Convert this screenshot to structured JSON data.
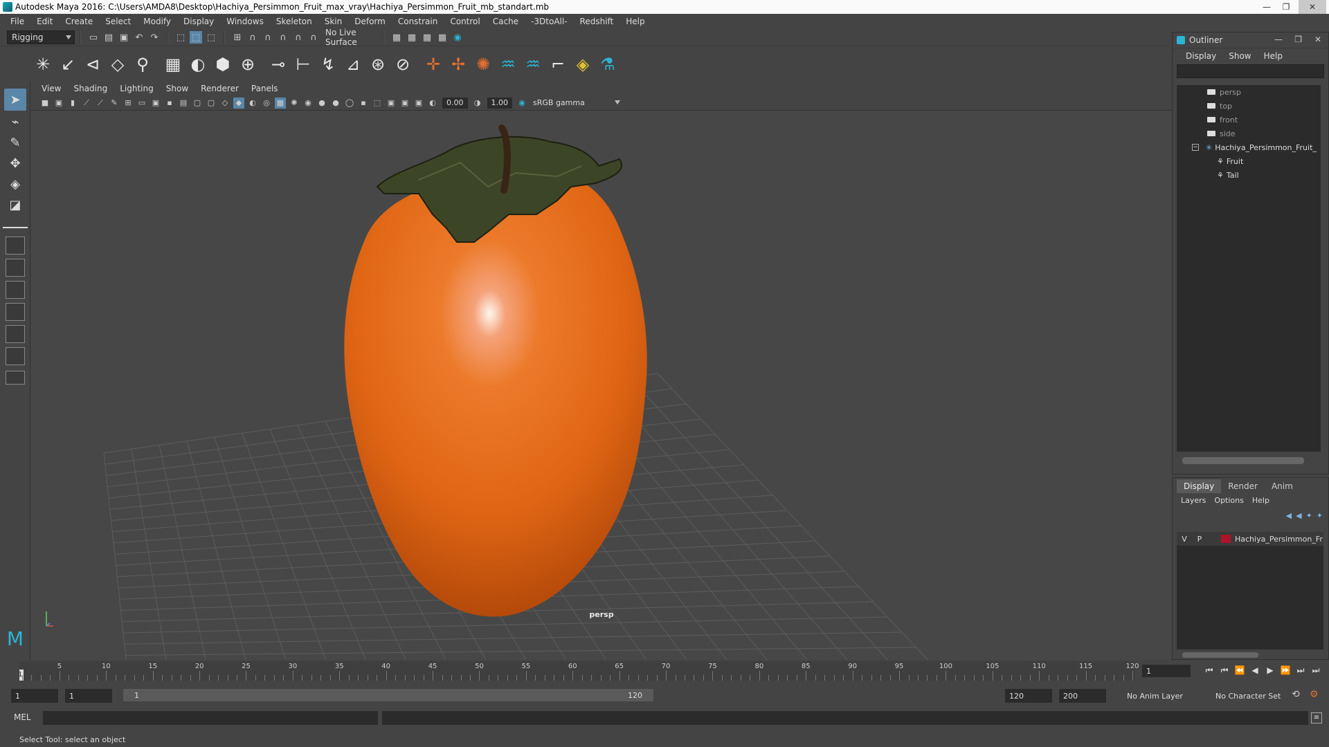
{
  "window": {
    "title": "Autodesk Maya 2016: C:\\Users\\AMDA8\\Desktop\\Hachiya_Persimmon_Fruit_max_vray\\Hachiya_Persimmon_Fruit_mb_standart.mb",
    "minimize": "—",
    "maximize": "❐",
    "close": "✕"
  },
  "menubar": [
    "File",
    "Edit",
    "Create",
    "Select",
    "Modify",
    "Display",
    "Windows",
    "Skeleton",
    "Skin",
    "Deform",
    "Constrain",
    "Control",
    "Cache",
    "-3DtoAll-",
    "Redshift",
    "Help"
  ],
  "statusline": {
    "menuset": "Rigging",
    "live_surface": "No Live Surface"
  },
  "viewport": {
    "menu": [
      "View",
      "Shading",
      "Lighting",
      "Show",
      "Renderer",
      "Panels"
    ],
    "exposure": "0.00",
    "gamma": "1.00",
    "color_space": "sRGB gamma",
    "camera_label": "persp"
  },
  "outliner": {
    "title": "Outliner",
    "menu": [
      "Display",
      "Show",
      "Help"
    ],
    "cameras": [
      "persp",
      "top",
      "front",
      "side"
    ],
    "group": "Hachiya_Persimmon_Fruit_",
    "children": [
      "Fruit",
      "Tail"
    ]
  },
  "layers": {
    "tabs": [
      "Display",
      "Render",
      "Anim"
    ],
    "menu": [
      "Layers",
      "Options",
      "Help"
    ],
    "row": {
      "v": "V",
      "p": "P",
      "name": "Hachiya_Persimmon_Fr",
      "color": "#b0122a"
    }
  },
  "timeline": {
    "start_marker": "1",
    "ticks": [
      "5",
      "10",
      "15",
      "20",
      "25",
      "30",
      "35",
      "40",
      "45",
      "50",
      "55",
      "60",
      "65",
      "70",
      "75",
      "80",
      "85",
      "90",
      "95",
      "100",
      "105",
      "110",
      "115",
      "120"
    ],
    "current_frame": "1"
  },
  "range": {
    "start": "1",
    "playback_start": "1",
    "bar_start": "1",
    "bar_end": "120",
    "playback_end": "120",
    "end": "200",
    "anim_layer": "No Anim Layer",
    "character_set": "No Character Set"
  },
  "commandline": {
    "label": "MEL"
  },
  "helpline": {
    "text": "Select Tool: select an object"
  }
}
